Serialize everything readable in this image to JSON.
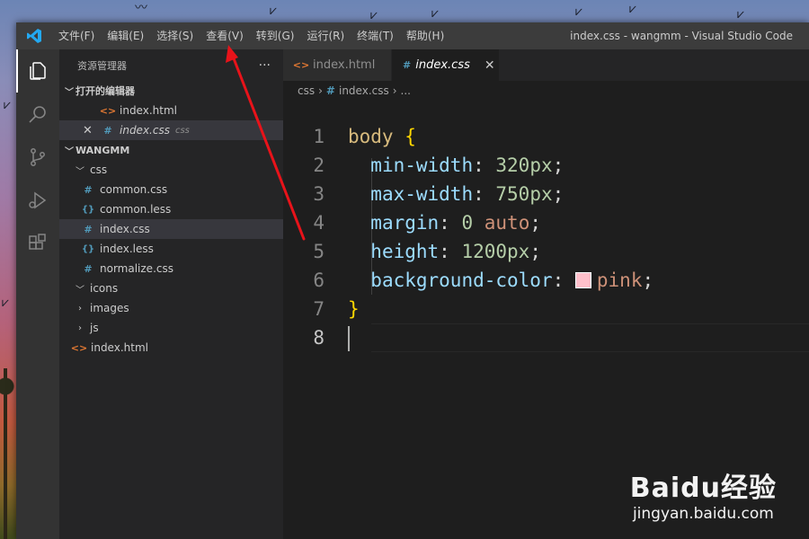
{
  "window_title": "index.css - wangmm - Visual Studio Code",
  "menu": [
    "文件(F)",
    "编辑(E)",
    "选择(S)",
    "查看(V)",
    "转到(G)",
    "运行(R)",
    "终端(T)",
    "帮助(H)"
  ],
  "activity_bar": {
    "icons": [
      "explorer-icon",
      "search-icon",
      "source-control-icon",
      "run-debug-icon",
      "extensions-icon"
    ]
  },
  "sidebar": {
    "title": "资源管理器",
    "more_label": "···",
    "open_editors_title": "打开的编辑器",
    "open_editors": [
      {
        "name": "index.html",
        "icon": "html-file-icon"
      },
      {
        "name": "index.css",
        "desc": "css",
        "icon": "css-file-icon"
      }
    ],
    "folder_title": "WANGMM",
    "tree": {
      "css_folder": "css",
      "css_files": [
        "common.css",
        "common.less",
        "index.css",
        "index.less",
        "normalize.css"
      ],
      "icons_folder": "icons",
      "images_folder": "images",
      "js_folder": "js",
      "root_file": "index.html"
    }
  },
  "tabs": [
    {
      "label": "index.html",
      "close": ""
    },
    {
      "label": "index.css",
      "close": "✕"
    }
  ],
  "breadcrumb": {
    "folder": "css",
    "file": "index.css",
    "more": "..."
  },
  "code": {
    "line_numbers": [
      "1",
      "2",
      "3",
      "4",
      "5",
      "6",
      "7",
      "8"
    ],
    "l1_sel": "body",
    "l1_brace": "{",
    "l2_prop": "min-width",
    "l2_val": "320px",
    "l3_prop": "max-width",
    "l3_val": "750px",
    "l4_prop": "margin",
    "l4_val1": "0",
    "l4_val2": "auto",
    "l5_prop": "height",
    "l5_val": "1200px",
    "l6_prop": "background-color",
    "l6_val": "pink",
    "l7_brace": "}"
  },
  "colors": {
    "swatch": "#ffc0cb",
    "arrow": "#e8131a"
  },
  "watermark": {
    "logo": "Baidu经验",
    "url": "jingyan.baidu.com"
  }
}
